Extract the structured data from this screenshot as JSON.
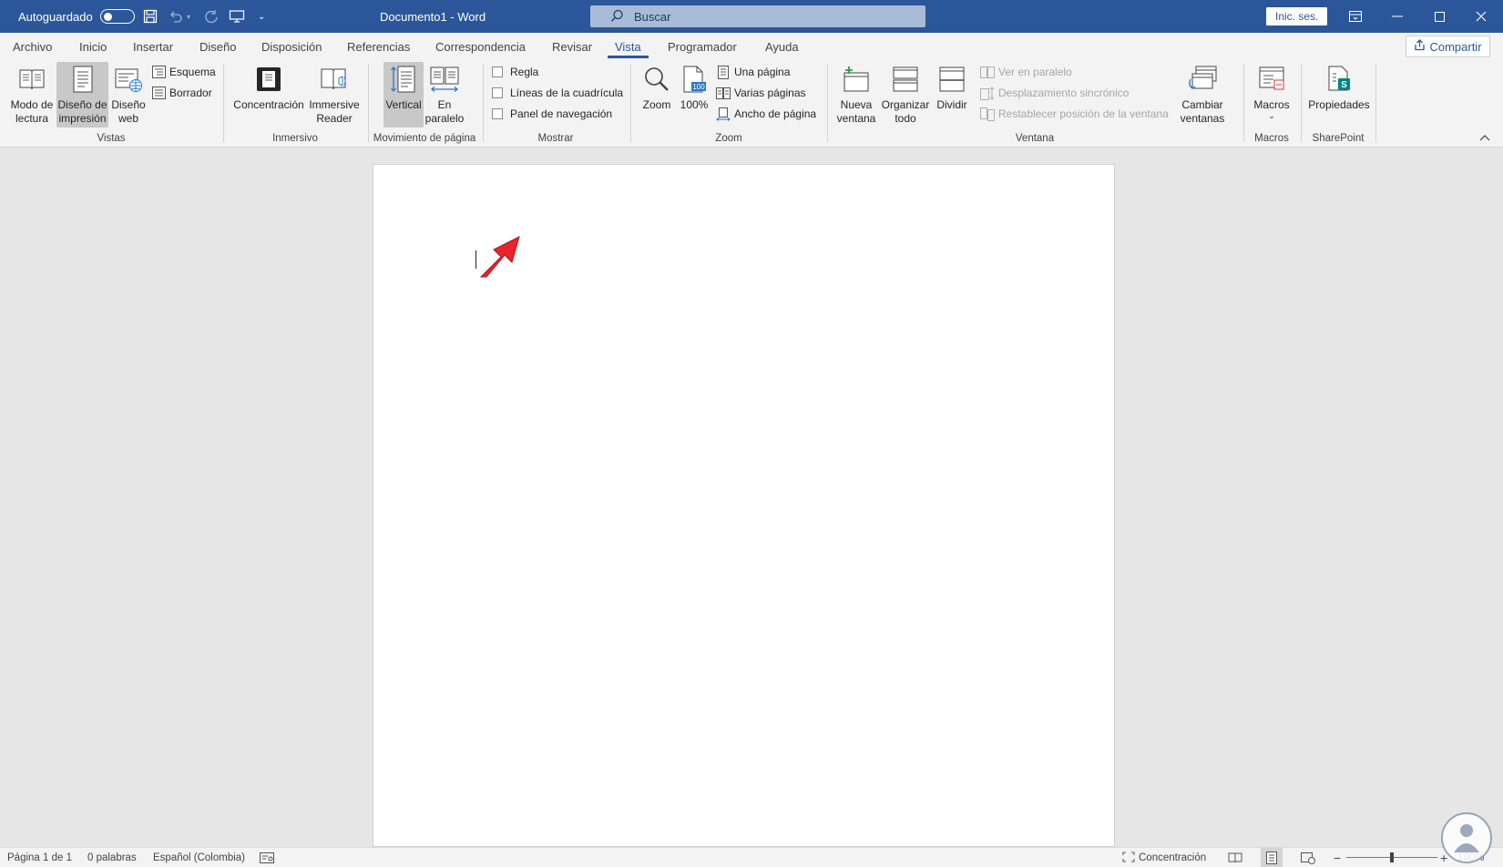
{
  "titlebar": {
    "autosave_label": "Autoguardado",
    "document_title": "Documento1 - Word",
    "search_placeholder": "Buscar",
    "signin_label": "Inic. ses."
  },
  "tabs": [
    {
      "label": "Archivo"
    },
    {
      "label": "Inicio"
    },
    {
      "label": "Insertar"
    },
    {
      "label": "Diseño"
    },
    {
      "label": "Disposición"
    },
    {
      "label": "Referencias"
    },
    {
      "label": "Correspondencia"
    },
    {
      "label": "Revisar"
    },
    {
      "label": "Vista",
      "active": true
    },
    {
      "label": "Programador"
    },
    {
      "label": "Ayuda"
    }
  ],
  "share_label": "Compartir",
  "ribbon": {
    "vistas": {
      "group_label": "Vistas",
      "read_mode": [
        "Modo de",
        "lectura"
      ],
      "print_layout": [
        "Diseño de",
        "impresión"
      ],
      "web_layout": [
        "Diseño",
        "web"
      ],
      "outline": "Esquema",
      "draft": "Borrador"
    },
    "inmersivo": {
      "group_label": "Inmersivo",
      "focus": "Concentración",
      "immersive_reader": [
        "Immersive",
        "Reader"
      ]
    },
    "movimiento": {
      "group_label": "Movimiento de página",
      "vertical": "Vertical",
      "side_by_side": [
        "En",
        "paralelo"
      ]
    },
    "mostrar": {
      "group_label": "Mostrar",
      "ruler": "Regla",
      "gridlines": "Líneas de la cuadrícula",
      "nav_pane": "Panel de navegación"
    },
    "zoom": {
      "group_label": "Zoom",
      "zoom": "Zoom",
      "hundred": "100%",
      "one_page": "Una página",
      "multiple_pages": "Varias páginas",
      "page_width": "Ancho de página"
    },
    "ventana": {
      "group_label": "Ventana",
      "new_window": [
        "Nueva",
        "ventana"
      ],
      "arrange_all": [
        "Organizar",
        "todo"
      ],
      "split": "Dividir",
      "view_side_by_side": "Ver en paralelo",
      "sync_scroll": "Desplazamiento sincrónico",
      "reset_position": "Restablecer posición de la ventana",
      "switch_windows": [
        "Cambiar",
        "ventanas"
      ]
    },
    "macros": {
      "group_label": "Macros",
      "macros": "Macros"
    },
    "sharepoint": {
      "group_label": "SharePoint",
      "properties": "Propiedades"
    }
  },
  "statusbar": {
    "page": "Página 1 de 1",
    "words": "0 palabras",
    "language": "Español (Colombia)",
    "focus": "Concentración",
    "zoom_level": "100%"
  },
  "colors": {
    "accent": "#2b579a",
    "arrow": "#e8242a"
  }
}
